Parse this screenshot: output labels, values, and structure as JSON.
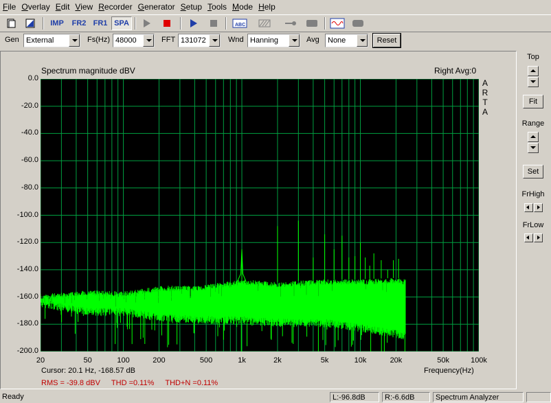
{
  "menu": [
    {
      "label": "File",
      "u": "F",
      "rest": "ile"
    },
    {
      "label": "Overlay",
      "u": "O",
      "rest": "verlay"
    },
    {
      "label": "Edit",
      "u": "E",
      "rest": "dit"
    },
    {
      "label": "View",
      "u": "V",
      "rest": "iew"
    },
    {
      "label": "Recorder",
      "u": "R",
      "rest": "ecorder"
    },
    {
      "label": "Generator",
      "u": "G",
      "rest": "enerator"
    },
    {
      "label": "Setup",
      "u": "S",
      "rest": "etup"
    },
    {
      "label": "Tools",
      "u": "T",
      "rest": "ools"
    },
    {
      "label": "Mode",
      "u": "M",
      "rest": "ode"
    },
    {
      "label": "Help",
      "u": "H",
      "rest": "elp"
    }
  ],
  "toolbar": {
    "imp_label": "IMP",
    "fr2_label": "FR2",
    "fr1_label": "FR1",
    "spa_label": "SPA"
  },
  "controls": {
    "gen_label": "Gen",
    "gen_value": "External",
    "fs_label": "Fs(Hz)",
    "fs_value": "48000",
    "fft_label": "FFT",
    "fft_value": "131072",
    "wnd_label": "Wnd",
    "wnd_value": "Hanning",
    "avg_label": "Avg",
    "avg_value": "None",
    "reset_label": "Reset"
  },
  "plot": {
    "title": "Spectrum magnitude dBV",
    "right_info": "Right Avg:0",
    "side_letters": [
      "A",
      "R",
      "T",
      "A"
    ],
    "cursor_text": "Cursor:  20.1 Hz, -168.57 dB",
    "xlabel": "Frequency(Hz)",
    "rms_text": "RMS =  -39.8 dBV",
    "thd_text": "THD =0.11%",
    "thdn_text": "THD+N =0.11%"
  },
  "chart_data": {
    "type": "line",
    "title": "Spectrum magnitude dBV",
    "xlabel": "Frequency(Hz)",
    "ylabel": "",
    "x_scale": "log",
    "xlim": [
      20,
      100000
    ],
    "ylim": [
      -200,
      0
    ],
    "grid": true,
    "xticks": [
      "20",
      "50",
      "100",
      "200",
      "500",
      "1k",
      "2k",
      "5k",
      "10k",
      "20k",
      "50k",
      "100k"
    ],
    "yticks": [
      "0.0",
      "-20.0",
      "-40.0",
      "-60.0",
      "-80.0",
      "-100.0",
      "-120.0",
      "-140.0",
      "-160.0",
      "-180.0",
      "-200.0"
    ],
    "noise_floor_top": [
      [
        20,
        -158
      ],
      [
        50,
        -155
      ],
      [
        100,
        -156
      ],
      [
        200,
        -152
      ],
      [
        500,
        -151
      ],
      [
        1000,
        -147
      ],
      [
        2000,
        -149
      ],
      [
        5000,
        -147
      ],
      [
        10000,
        -147
      ],
      [
        20000,
        -146
      ],
      [
        24000,
        -147
      ]
    ],
    "noise_floor_bottom": [
      [
        20,
        -162
      ],
      [
        50,
        -168
      ],
      [
        100,
        -168
      ],
      [
        200,
        -172
      ],
      [
        500,
        -174
      ],
      [
        1000,
        -174
      ],
      [
        2000,
        -176
      ],
      [
        5000,
        -176
      ],
      [
        10000,
        -180
      ],
      [
        20000,
        -184
      ],
      [
        24000,
        -186
      ]
    ],
    "peaks": [
      {
        "freq": 1000,
        "db": -125
      },
      {
        "freq": 2000,
        "db": -108
      },
      {
        "freq": 3000,
        "db": -104
      },
      {
        "freq": 4000,
        "db": -131
      },
      {
        "freq": 5000,
        "db": -114
      },
      {
        "freq": 6000,
        "db": -125
      },
      {
        "freq": 7000,
        "db": -115
      },
      {
        "freq": 8000,
        "db": -131
      },
      {
        "freq": 9000,
        "db": -130
      },
      {
        "freq": 10000,
        "db": -120
      },
      {
        "freq": 11000,
        "db": -131
      },
      {
        "freq": 12000,
        "db": -137
      },
      {
        "freq": 13000,
        "db": -128
      },
      {
        "freq": 15000,
        "db": -133
      },
      {
        "freq": 17000,
        "db": -140
      },
      {
        "freq": 19000,
        "db": -133
      },
      {
        "freq": 21000,
        "db": -132
      }
    ],
    "trace_color": "#00ff00",
    "background": "#000000",
    "grid_color": "#00a040"
  },
  "side_panel": {
    "top_label": "Top",
    "fit_label": "Fit",
    "range_label": "Range",
    "set_label": "Set",
    "frhigh_label": "FrHigh",
    "frlow_label": "FrLow"
  },
  "status": {
    "ready": "Ready",
    "left_level": "L:-96.8dB",
    "right_level": "R:-6.6dB",
    "mode": "Spectrum Analyzer"
  }
}
